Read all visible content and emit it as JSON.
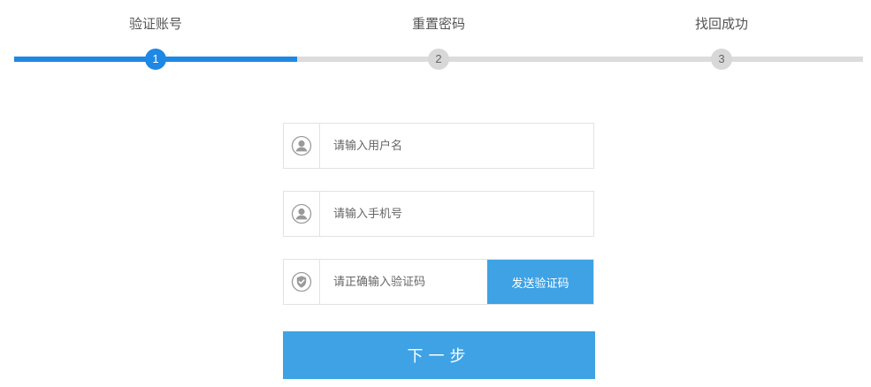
{
  "steps": [
    {
      "label": "验证账号",
      "number": "1",
      "state": "active"
    },
    {
      "label": "重置密码",
      "number": "2",
      "state": "pending"
    },
    {
      "label": "找回成功",
      "number": "3",
      "state": "pending"
    }
  ],
  "form": {
    "username": {
      "placeholder": "请输入用户名",
      "value": "",
      "icon": "user-icon"
    },
    "phone": {
      "placeholder": "请输入手机号",
      "value": "",
      "icon": "user-icon"
    },
    "code": {
      "placeholder": "请正确输入验证码",
      "value": "",
      "icon": "shield-check-icon"
    },
    "send_code_label": "发送验证码",
    "next_label": "下一步"
  },
  "colors": {
    "accent": "#1e88e5",
    "button": "#3ea2e5",
    "track": "#dcdcdc",
    "border": "#e2e2e2"
  }
}
